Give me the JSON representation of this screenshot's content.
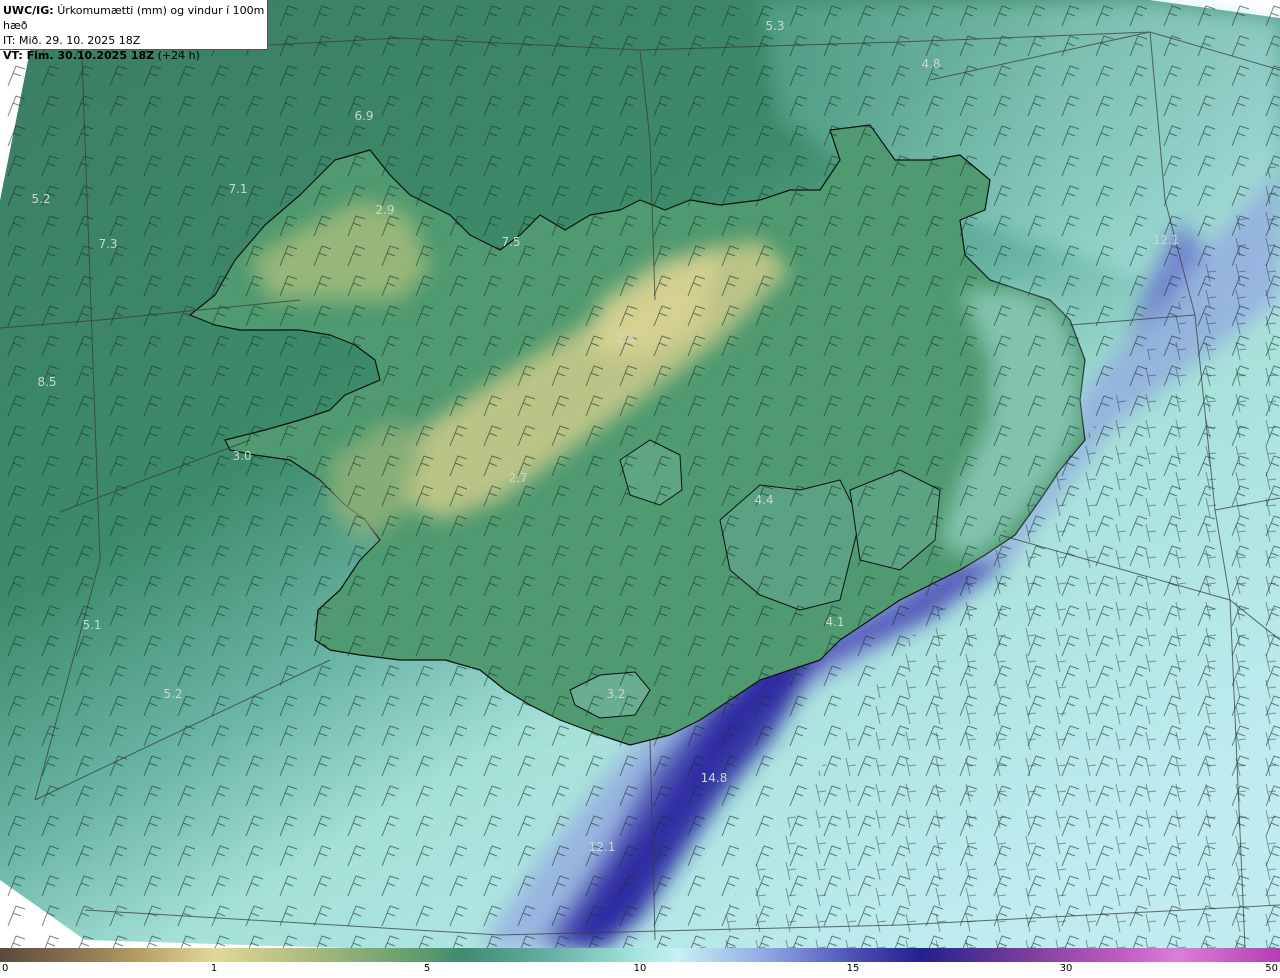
{
  "header": {
    "product": "UWC/IG:",
    "title": "Úrkomumætti (mm) og vindur í 100m hæð",
    "init_time": "IT: Mið. 29. 10. 2025 18Z",
    "valid_time": "VT: Fim. 30.10.2025 18Z",
    "lead": "(+24 h)"
  },
  "map_values": [
    {
      "text": "5.3"
    },
    {
      "text": "4.8"
    },
    {
      "text": "6.9"
    },
    {
      "text": "7.1"
    },
    {
      "text": "5.2"
    },
    {
      "text": "7.3"
    },
    {
      "text": "2.9"
    },
    {
      "text": "7.5"
    },
    {
      "text": "12.1"
    },
    {
      "text": "2.8"
    },
    {
      "text": "8.5"
    },
    {
      "text": "3.0"
    },
    {
      "text": "2.7"
    },
    {
      "text": "4.4"
    },
    {
      "text": "4.1"
    },
    {
      "text": "5.1"
    },
    {
      "text": "5.2"
    },
    {
      "text": "3.2"
    },
    {
      "text": "14.8"
    },
    {
      "text": "12.1"
    }
  ],
  "colorbar": {
    "ticks": [
      "0",
      "1",
      "5",
      "10",
      "15",
      "30",
      "50"
    ]
  },
  "colors": {
    "dry": "#d9d08c",
    "moderate": "#3f8a72",
    "wet": "#a8e6e0",
    "heavy": "#22208e",
    "extreme": "#b73cb3"
  }
}
